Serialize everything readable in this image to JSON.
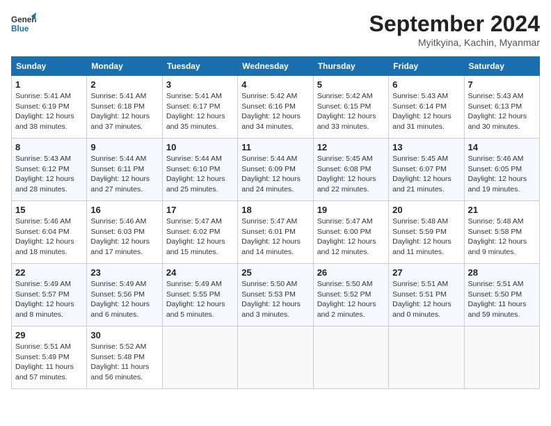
{
  "header": {
    "logo_text_general": "General",
    "logo_text_blue": "Blue",
    "month_title": "September 2024",
    "location": "Myitkyina, Kachin, Myanmar"
  },
  "columns": [
    "Sunday",
    "Monday",
    "Tuesday",
    "Wednesday",
    "Thursday",
    "Friday",
    "Saturday"
  ],
  "weeks": [
    [
      {
        "day": "1",
        "info": "Sunrise: 5:41 AM\nSunset: 6:19 PM\nDaylight: 12 hours\nand 38 minutes."
      },
      {
        "day": "2",
        "info": "Sunrise: 5:41 AM\nSunset: 6:18 PM\nDaylight: 12 hours\nand 37 minutes."
      },
      {
        "day": "3",
        "info": "Sunrise: 5:41 AM\nSunset: 6:17 PM\nDaylight: 12 hours\nand 35 minutes."
      },
      {
        "day": "4",
        "info": "Sunrise: 5:42 AM\nSunset: 6:16 PM\nDaylight: 12 hours\nand 34 minutes."
      },
      {
        "day": "5",
        "info": "Sunrise: 5:42 AM\nSunset: 6:15 PM\nDaylight: 12 hours\nand 33 minutes."
      },
      {
        "day": "6",
        "info": "Sunrise: 5:43 AM\nSunset: 6:14 PM\nDaylight: 12 hours\nand 31 minutes."
      },
      {
        "day": "7",
        "info": "Sunrise: 5:43 AM\nSunset: 6:13 PM\nDaylight: 12 hours\nand 30 minutes."
      }
    ],
    [
      {
        "day": "8",
        "info": "Sunrise: 5:43 AM\nSunset: 6:12 PM\nDaylight: 12 hours\nand 28 minutes."
      },
      {
        "day": "9",
        "info": "Sunrise: 5:44 AM\nSunset: 6:11 PM\nDaylight: 12 hours\nand 27 minutes."
      },
      {
        "day": "10",
        "info": "Sunrise: 5:44 AM\nSunset: 6:10 PM\nDaylight: 12 hours\nand 25 minutes."
      },
      {
        "day": "11",
        "info": "Sunrise: 5:44 AM\nSunset: 6:09 PM\nDaylight: 12 hours\nand 24 minutes."
      },
      {
        "day": "12",
        "info": "Sunrise: 5:45 AM\nSunset: 6:08 PM\nDaylight: 12 hours\nand 22 minutes."
      },
      {
        "day": "13",
        "info": "Sunrise: 5:45 AM\nSunset: 6:07 PM\nDaylight: 12 hours\nand 21 minutes."
      },
      {
        "day": "14",
        "info": "Sunrise: 5:46 AM\nSunset: 6:05 PM\nDaylight: 12 hours\nand 19 minutes."
      }
    ],
    [
      {
        "day": "15",
        "info": "Sunrise: 5:46 AM\nSunset: 6:04 PM\nDaylight: 12 hours\nand 18 minutes."
      },
      {
        "day": "16",
        "info": "Sunrise: 5:46 AM\nSunset: 6:03 PM\nDaylight: 12 hours\nand 17 minutes."
      },
      {
        "day": "17",
        "info": "Sunrise: 5:47 AM\nSunset: 6:02 PM\nDaylight: 12 hours\nand 15 minutes."
      },
      {
        "day": "18",
        "info": "Sunrise: 5:47 AM\nSunset: 6:01 PM\nDaylight: 12 hours\nand 14 minutes."
      },
      {
        "day": "19",
        "info": "Sunrise: 5:47 AM\nSunset: 6:00 PM\nDaylight: 12 hours\nand 12 minutes."
      },
      {
        "day": "20",
        "info": "Sunrise: 5:48 AM\nSunset: 5:59 PM\nDaylight: 12 hours\nand 11 minutes."
      },
      {
        "day": "21",
        "info": "Sunrise: 5:48 AM\nSunset: 5:58 PM\nDaylight: 12 hours\nand 9 minutes."
      }
    ],
    [
      {
        "day": "22",
        "info": "Sunrise: 5:49 AM\nSunset: 5:57 PM\nDaylight: 12 hours\nand 8 minutes."
      },
      {
        "day": "23",
        "info": "Sunrise: 5:49 AM\nSunset: 5:56 PM\nDaylight: 12 hours\nand 6 minutes."
      },
      {
        "day": "24",
        "info": "Sunrise: 5:49 AM\nSunset: 5:55 PM\nDaylight: 12 hours\nand 5 minutes."
      },
      {
        "day": "25",
        "info": "Sunrise: 5:50 AM\nSunset: 5:53 PM\nDaylight: 12 hours\nand 3 minutes."
      },
      {
        "day": "26",
        "info": "Sunrise: 5:50 AM\nSunset: 5:52 PM\nDaylight: 12 hours\nand 2 minutes."
      },
      {
        "day": "27",
        "info": "Sunrise: 5:51 AM\nSunset: 5:51 PM\nDaylight: 12 hours\nand 0 minutes."
      },
      {
        "day": "28",
        "info": "Sunrise: 5:51 AM\nSunset: 5:50 PM\nDaylight: 11 hours\nand 59 minutes."
      }
    ],
    [
      {
        "day": "29",
        "info": "Sunrise: 5:51 AM\nSunset: 5:49 PM\nDaylight: 11 hours\nand 57 minutes."
      },
      {
        "day": "30",
        "info": "Sunrise: 5:52 AM\nSunset: 5:48 PM\nDaylight: 11 hours\nand 56 minutes."
      },
      {
        "day": "",
        "info": ""
      },
      {
        "day": "",
        "info": ""
      },
      {
        "day": "",
        "info": ""
      },
      {
        "day": "",
        "info": ""
      },
      {
        "day": "",
        "info": ""
      }
    ]
  ]
}
